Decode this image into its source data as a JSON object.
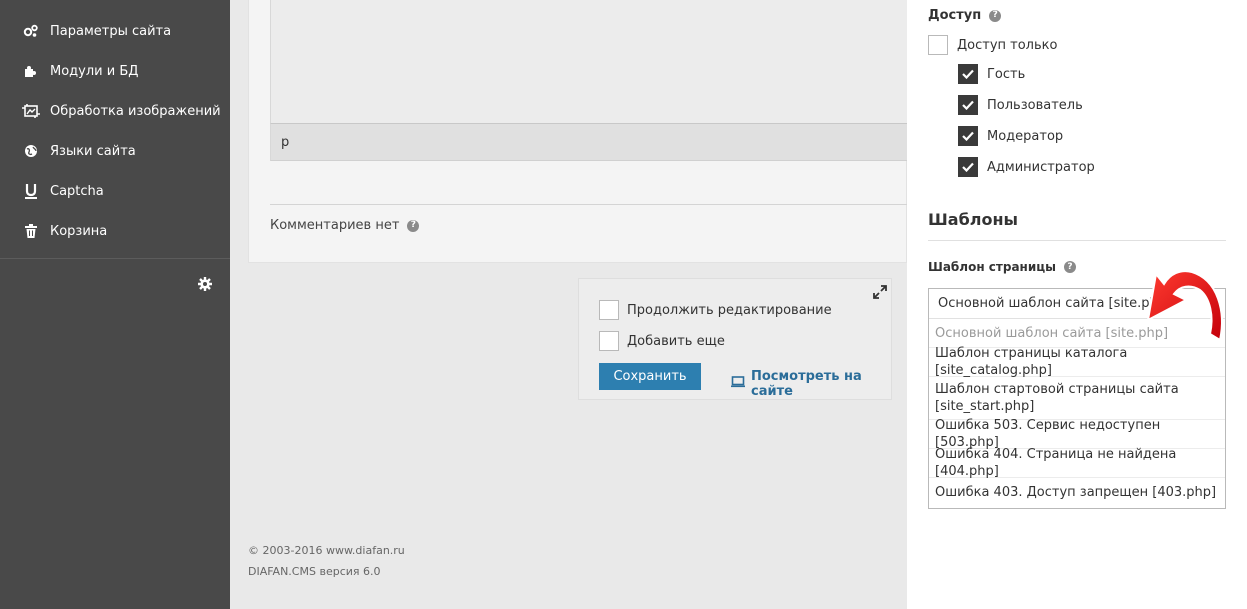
{
  "sidebar": {
    "items": [
      {
        "label": "Параметры сайта",
        "icon": "gears-icon"
      },
      {
        "label": "Модули и БД",
        "icon": "puzzle-icon"
      },
      {
        "label": "Обработка изображений",
        "icon": "image-crop-icon"
      },
      {
        "label": "Языки сайта",
        "icon": "globe-icon"
      },
      {
        "label": "Captcha",
        "icon": "captcha-icon"
      },
      {
        "label": "Корзина",
        "icon": "trash-icon"
      }
    ]
  },
  "editor": {
    "status_path": "p"
  },
  "comments": {
    "label": "Комментариев нет"
  },
  "save_box": {
    "continue_label": "Продолжить редактирование",
    "add_more_label": "Добавить еще",
    "save_label": "Сохранить",
    "view_label": "Посмотреть на сайте"
  },
  "footer": {
    "copyright": "© 2003-2016 www.diafan.ru",
    "version": "DIAFAN.CMS версия 6.0"
  },
  "access": {
    "title": "Доступ",
    "only_label": "Доступ только",
    "roles": [
      {
        "label": "Гость",
        "checked": true
      },
      {
        "label": "Пользователь",
        "checked": true
      },
      {
        "label": "Модератор",
        "checked": true
      },
      {
        "label": "Администратор",
        "checked": true
      }
    ]
  },
  "templates": {
    "title": "Шаблоны",
    "page_template_label": "Шаблон страницы",
    "selected": "Основной шаблон сайта [site.php]",
    "options": [
      "Основной шаблон сайта [site.php]",
      "Шаблон страницы каталога [site_catalog.php]",
      "Шаблон стартовой страницы сайта [site_start.php]",
      "Ошибка 503. Сервис недоступен [503.php]",
      "Ошибка 404. Страница не найдена [404.php]",
      "Ошибка 403. Доступ запрещен [403.php]"
    ]
  },
  "colors": {
    "sidebar_bg": "#494949",
    "accent": "#2d7fb0",
    "link": "#2b6d99",
    "annotation_arrow": "#e8101a"
  }
}
